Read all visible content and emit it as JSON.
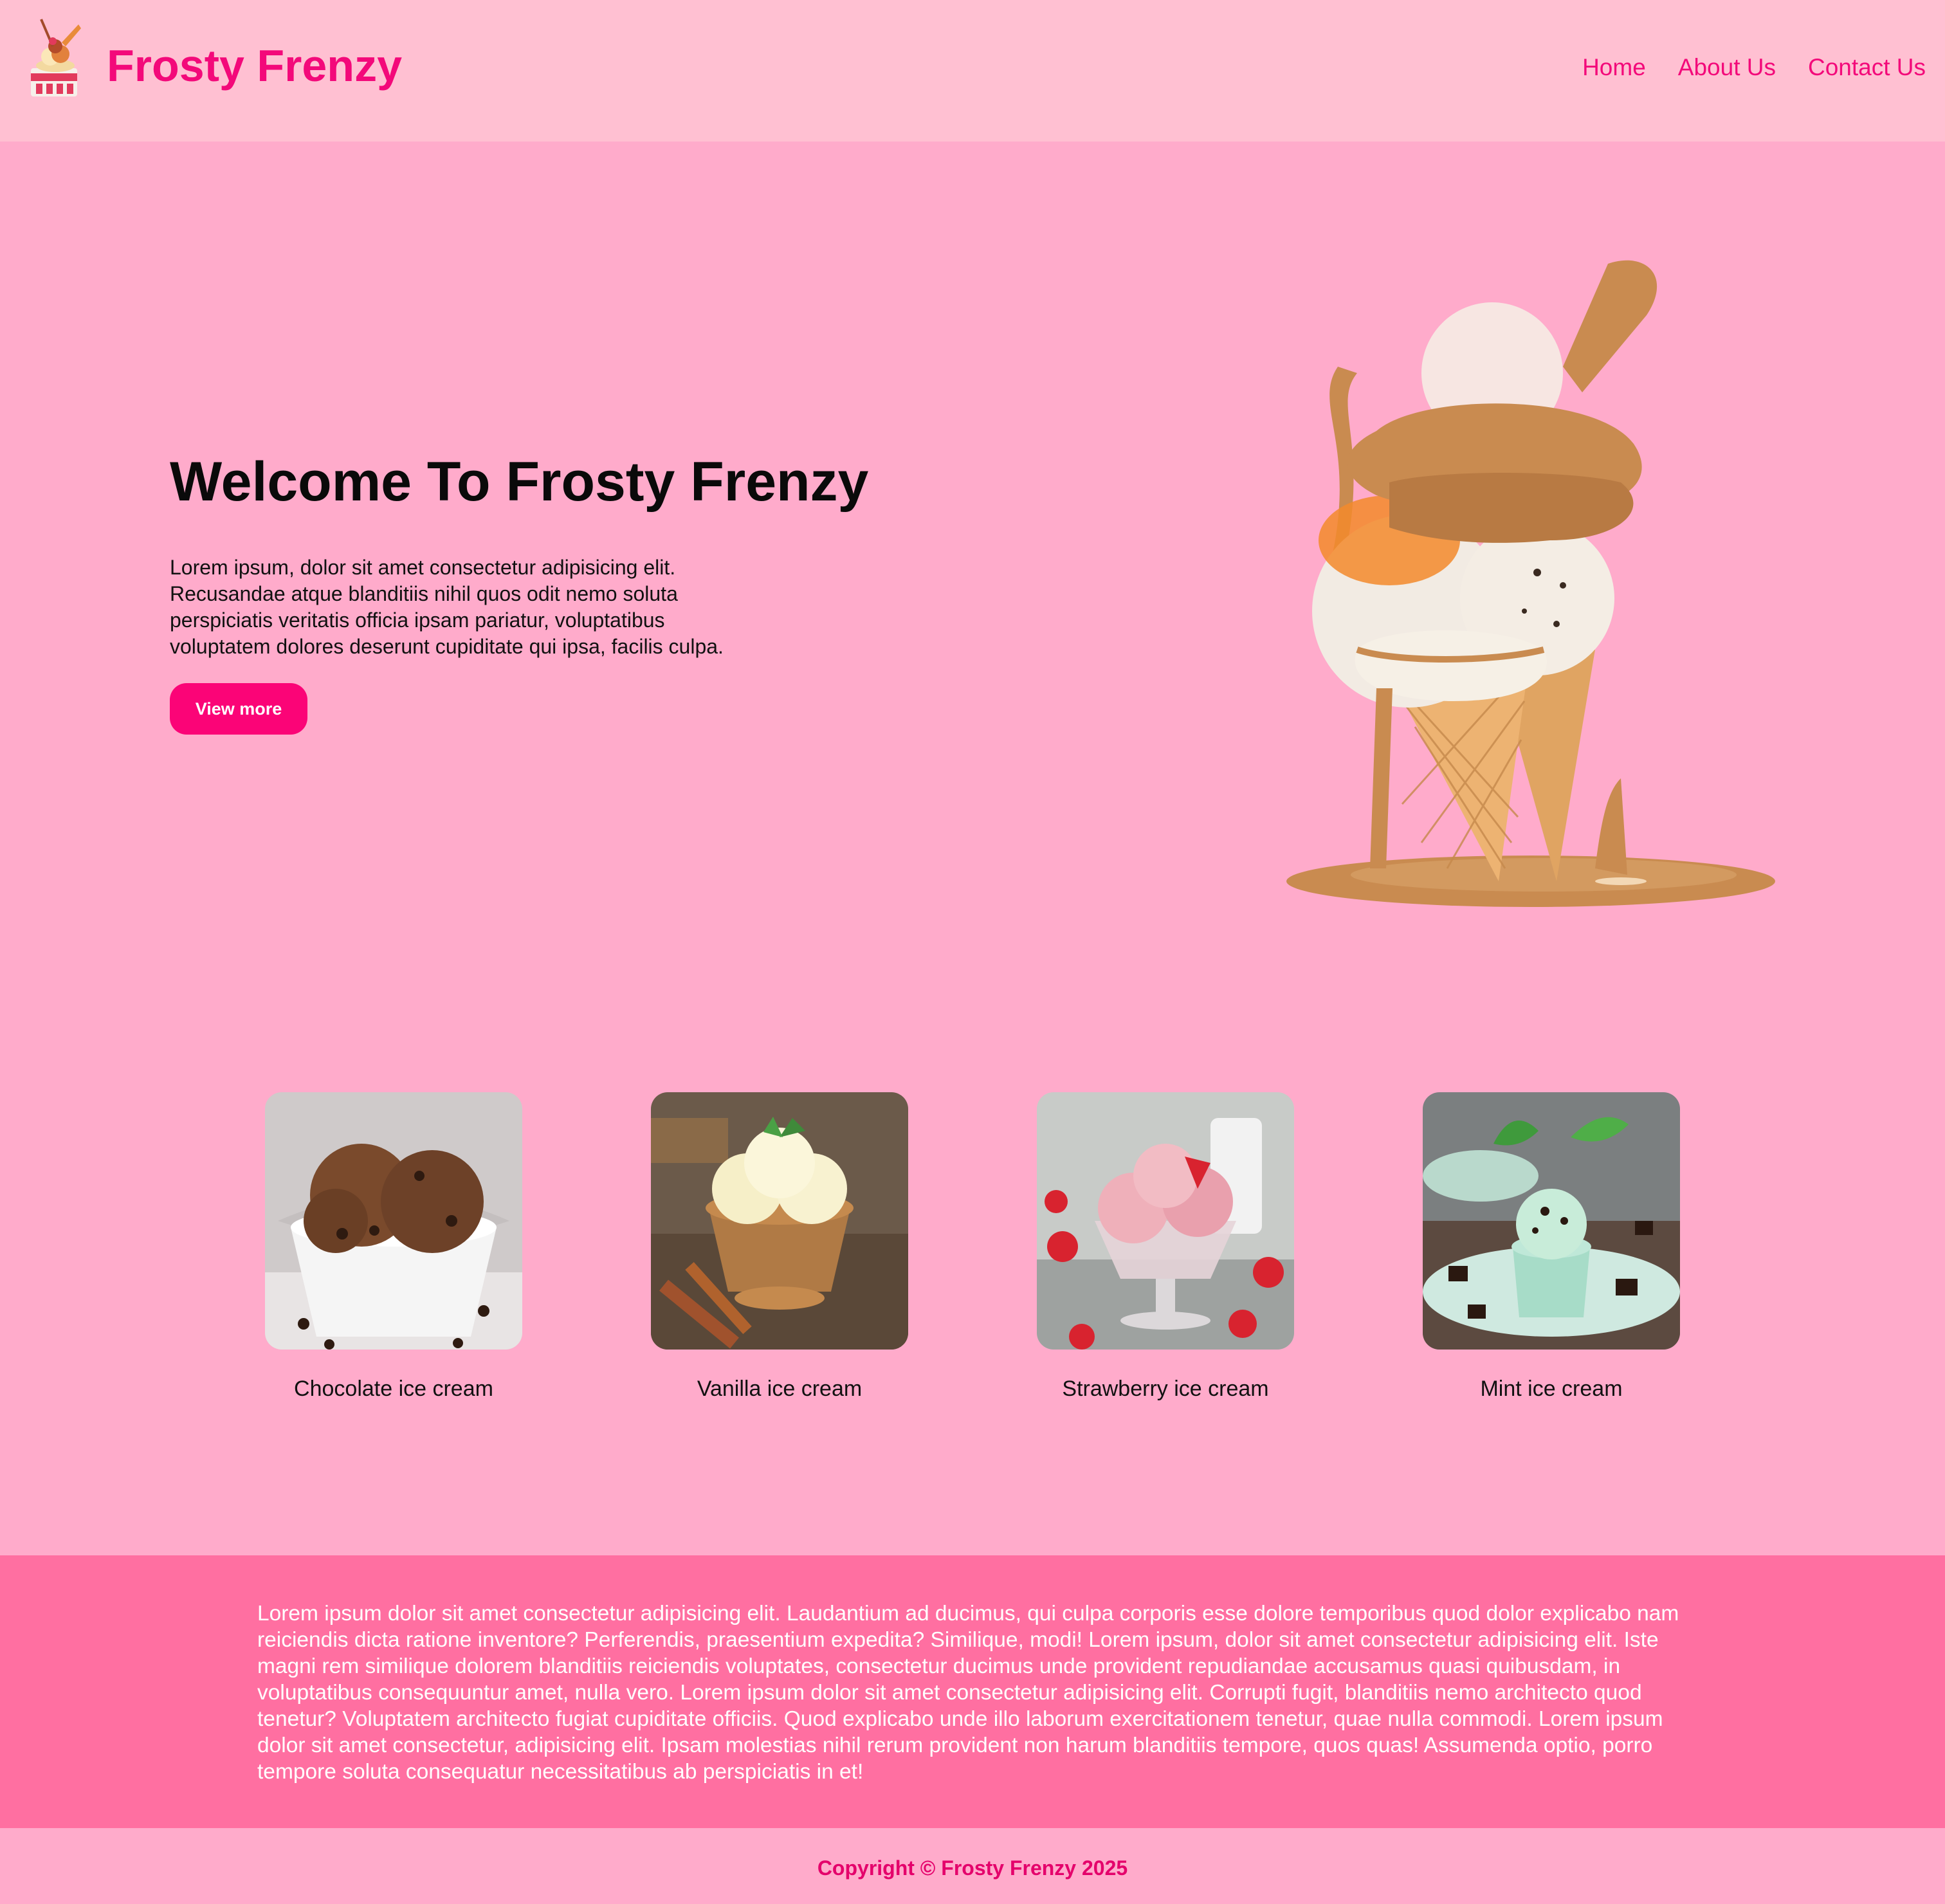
{
  "header": {
    "brand": "Frosty Frenzy",
    "nav": [
      "Home",
      "About Us",
      "Contact Us"
    ]
  },
  "hero": {
    "title": "Welcome To Frosty Frenzy",
    "text": "Lorem ipsum, dolor sit amet consectetur adipisicing elit. Recusandae atque blanditiis nihil quos odit nemo soluta perspiciatis veritatis officia ipsam pariatur, voluptatibus voluptatem dolores deserunt cupiditate qui ipsa, facilis culpa.",
    "button": "View more"
  },
  "flavors": [
    {
      "label": "Chocolate ice cream"
    },
    {
      "label": "Vanilla ice cream"
    },
    {
      "label": "Strawberry ice cream"
    },
    {
      "label": "Mint ice cream"
    }
  ],
  "about": {
    "text": "Lorem ipsum dolor sit amet consectetur adipisicing elit. Laudantium ad ducimus, qui culpa corporis esse dolore temporibus quod dolor explicabo nam reiciendis dicta ratione inventore? Perferendis, praesentium expedita? Similique, modi! Lorem ipsum, dolor sit amet consectetur adipisicing elit. Iste magni rem similique dolorem blanditiis reiciendis voluptates, consectetur ducimus unde provident repudiandae accusamus quasi quibusdam, in voluptatibus consequuntur amet, nulla vero. Lorem ipsum dolor sit amet consectetur adipisicing elit. Corrupti fugit, blanditiis nemo architecto quod tenetur? Voluptatem architecto fugiat cupiditate officiis. Quod explicabo unde illo laborum exercitationem tenetur, quae nulla commodi. Lorem ipsum dolor sit amet consectetur, adipisicing elit. Ipsam molestias nihil rerum provident non harum blanditiis tempore, quos quas! Assumenda optio, porro tempore soluta consequatur necessitatibus ab perspiciatis in et!"
  },
  "footer": {
    "copyright": "Copyright © Frosty Frenzy 2025"
  },
  "colors": {
    "page_bg": "#ffabcb",
    "header_bg": "#ffc0d2",
    "accent": "#f3097a",
    "about_bg": "#ff6fa1"
  }
}
